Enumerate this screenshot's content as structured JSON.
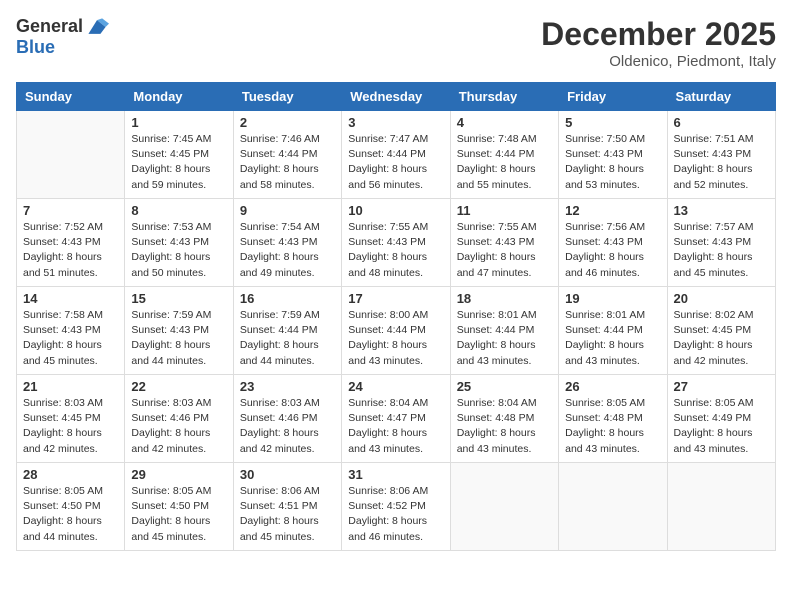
{
  "header": {
    "logo_general": "General",
    "logo_blue": "Blue",
    "month_title": "December 2025",
    "location": "Oldenico, Piedmont, Italy"
  },
  "weekdays": [
    "Sunday",
    "Monday",
    "Tuesday",
    "Wednesday",
    "Thursday",
    "Friday",
    "Saturday"
  ],
  "weeks": [
    [
      {
        "day": "",
        "info": ""
      },
      {
        "day": "1",
        "info": "Sunrise: 7:45 AM\nSunset: 4:45 PM\nDaylight: 8 hours\nand 59 minutes."
      },
      {
        "day": "2",
        "info": "Sunrise: 7:46 AM\nSunset: 4:44 PM\nDaylight: 8 hours\nand 58 minutes."
      },
      {
        "day": "3",
        "info": "Sunrise: 7:47 AM\nSunset: 4:44 PM\nDaylight: 8 hours\nand 56 minutes."
      },
      {
        "day": "4",
        "info": "Sunrise: 7:48 AM\nSunset: 4:44 PM\nDaylight: 8 hours\nand 55 minutes."
      },
      {
        "day": "5",
        "info": "Sunrise: 7:50 AM\nSunset: 4:43 PM\nDaylight: 8 hours\nand 53 minutes."
      },
      {
        "day": "6",
        "info": "Sunrise: 7:51 AM\nSunset: 4:43 PM\nDaylight: 8 hours\nand 52 minutes."
      }
    ],
    [
      {
        "day": "7",
        "info": "Sunrise: 7:52 AM\nSunset: 4:43 PM\nDaylight: 8 hours\nand 51 minutes."
      },
      {
        "day": "8",
        "info": "Sunrise: 7:53 AM\nSunset: 4:43 PM\nDaylight: 8 hours\nand 50 minutes."
      },
      {
        "day": "9",
        "info": "Sunrise: 7:54 AM\nSunset: 4:43 PM\nDaylight: 8 hours\nand 49 minutes."
      },
      {
        "day": "10",
        "info": "Sunrise: 7:55 AM\nSunset: 4:43 PM\nDaylight: 8 hours\nand 48 minutes."
      },
      {
        "day": "11",
        "info": "Sunrise: 7:55 AM\nSunset: 4:43 PM\nDaylight: 8 hours\nand 47 minutes."
      },
      {
        "day": "12",
        "info": "Sunrise: 7:56 AM\nSunset: 4:43 PM\nDaylight: 8 hours\nand 46 minutes."
      },
      {
        "day": "13",
        "info": "Sunrise: 7:57 AM\nSunset: 4:43 PM\nDaylight: 8 hours\nand 45 minutes."
      }
    ],
    [
      {
        "day": "14",
        "info": "Sunrise: 7:58 AM\nSunset: 4:43 PM\nDaylight: 8 hours\nand 45 minutes."
      },
      {
        "day": "15",
        "info": "Sunrise: 7:59 AM\nSunset: 4:43 PM\nDaylight: 8 hours\nand 44 minutes."
      },
      {
        "day": "16",
        "info": "Sunrise: 7:59 AM\nSunset: 4:44 PM\nDaylight: 8 hours\nand 44 minutes."
      },
      {
        "day": "17",
        "info": "Sunrise: 8:00 AM\nSunset: 4:44 PM\nDaylight: 8 hours\nand 43 minutes."
      },
      {
        "day": "18",
        "info": "Sunrise: 8:01 AM\nSunset: 4:44 PM\nDaylight: 8 hours\nand 43 minutes."
      },
      {
        "day": "19",
        "info": "Sunrise: 8:01 AM\nSunset: 4:44 PM\nDaylight: 8 hours\nand 43 minutes."
      },
      {
        "day": "20",
        "info": "Sunrise: 8:02 AM\nSunset: 4:45 PM\nDaylight: 8 hours\nand 42 minutes."
      }
    ],
    [
      {
        "day": "21",
        "info": "Sunrise: 8:03 AM\nSunset: 4:45 PM\nDaylight: 8 hours\nand 42 minutes."
      },
      {
        "day": "22",
        "info": "Sunrise: 8:03 AM\nSunset: 4:46 PM\nDaylight: 8 hours\nand 42 minutes."
      },
      {
        "day": "23",
        "info": "Sunrise: 8:03 AM\nSunset: 4:46 PM\nDaylight: 8 hours\nand 42 minutes."
      },
      {
        "day": "24",
        "info": "Sunrise: 8:04 AM\nSunset: 4:47 PM\nDaylight: 8 hours\nand 43 minutes."
      },
      {
        "day": "25",
        "info": "Sunrise: 8:04 AM\nSunset: 4:48 PM\nDaylight: 8 hours\nand 43 minutes."
      },
      {
        "day": "26",
        "info": "Sunrise: 8:05 AM\nSunset: 4:48 PM\nDaylight: 8 hours\nand 43 minutes."
      },
      {
        "day": "27",
        "info": "Sunrise: 8:05 AM\nSunset: 4:49 PM\nDaylight: 8 hours\nand 43 minutes."
      }
    ],
    [
      {
        "day": "28",
        "info": "Sunrise: 8:05 AM\nSunset: 4:50 PM\nDaylight: 8 hours\nand 44 minutes."
      },
      {
        "day": "29",
        "info": "Sunrise: 8:05 AM\nSunset: 4:50 PM\nDaylight: 8 hours\nand 45 minutes."
      },
      {
        "day": "30",
        "info": "Sunrise: 8:06 AM\nSunset: 4:51 PM\nDaylight: 8 hours\nand 45 minutes."
      },
      {
        "day": "31",
        "info": "Sunrise: 8:06 AM\nSunset: 4:52 PM\nDaylight: 8 hours\nand 46 minutes."
      },
      {
        "day": "",
        "info": ""
      },
      {
        "day": "",
        "info": ""
      },
      {
        "day": "",
        "info": ""
      }
    ]
  ]
}
